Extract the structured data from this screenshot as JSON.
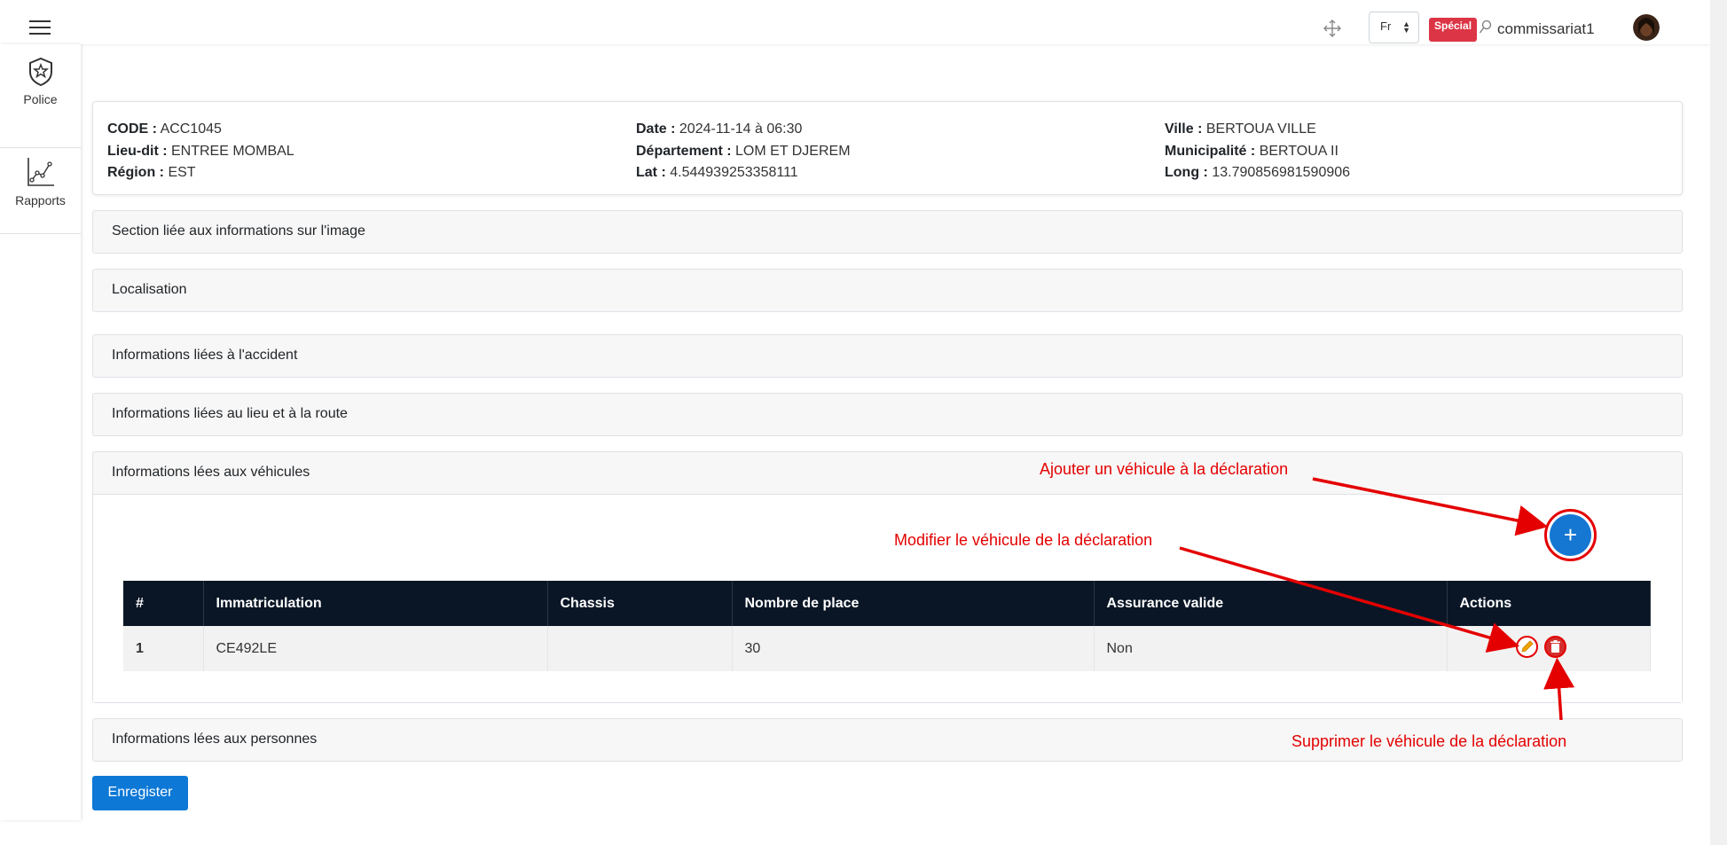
{
  "header": {
    "language": "Fr",
    "special_badge": "Spécial",
    "username": "commissariat1"
  },
  "sidebar": {
    "items": [
      {
        "label": "Police",
        "icon": "shield-star-icon"
      },
      {
        "label": "Rapports",
        "icon": "chart-line-icon"
      }
    ]
  },
  "info": {
    "code_label": "CODE :",
    "code": "ACC1045",
    "lieu_label": "Lieu-dit :",
    "lieu": "ENTREE MOMBAL",
    "region_label": "Région :",
    "region": "EST",
    "date_label": "Date :",
    "date": "2024-11-14 à 06:30",
    "dept_label": "Département :",
    "dept": "LOM ET DJEREM",
    "lat_label": "Lat :",
    "lat": "4.544939253358111",
    "ville_label": "Ville :",
    "ville": "BERTOUA VILLE",
    "muni_label": "Municipalité :",
    "muni": "BERTOUA II",
    "long_label": "Long :",
    "long": "13.790856981590906"
  },
  "sections": {
    "image": "Section liée aux informations sur l'image",
    "localisation": "Localisation",
    "accident": "Informations liées à l'accident",
    "lieu_route": "Informations liées au lieu et à la route",
    "vehicules": "Informations lées aux véhicules",
    "personnes": "Informations lées aux personnes"
  },
  "vehicle_table": {
    "columns": [
      "#",
      "Immatriculation",
      "Chassis",
      "Nombre de place",
      "Assurance valide",
      "Actions"
    ],
    "rows": [
      {
        "num": "1",
        "immatriculation": "CE492LE",
        "chassis": "",
        "places": "30",
        "assurance": "Non"
      }
    ]
  },
  "buttons": {
    "add": "+",
    "save": "Enregister"
  },
  "annotations": {
    "add": "Ajouter un véhicule à la déclaration",
    "edit": "Modifier le véhicule de la déclaration",
    "delete": "Supprimer le véhicule de la déclaration"
  },
  "colors": {
    "primary": "#1577d2",
    "danger": "#dc3545",
    "annotation": "#e40000",
    "table_header": "#0a1626"
  }
}
